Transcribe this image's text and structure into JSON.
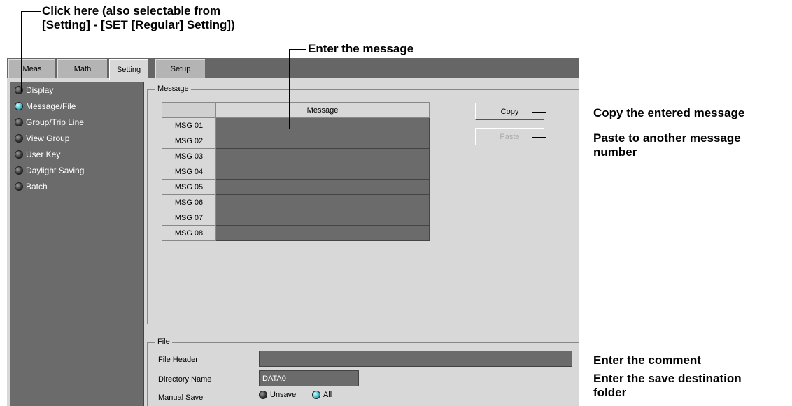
{
  "callouts": {
    "click_here_line1": "Click here (also selectable from",
    "click_here_line2": "[Setting] - [SET [Regular] Setting])",
    "enter_message": "Enter the message",
    "copy_desc": "Copy the entered message",
    "paste_desc_line1": "Paste to another message",
    "paste_desc_line2": "number",
    "enter_comment": "Enter the comment",
    "save_dest_line1": "Enter the save destination",
    "save_dest_line2": "folder"
  },
  "tabs": [
    {
      "label": "Meas",
      "active": false
    },
    {
      "label": "Math",
      "active": false
    },
    {
      "label": "Setting",
      "active": true
    },
    {
      "label": "Setup",
      "active": false
    }
  ],
  "sidebar": {
    "items": [
      {
        "label": "Display",
        "selected": false
      },
      {
        "label": "Message/File",
        "selected": true
      },
      {
        "label": "Group/Trip Line",
        "selected": false
      },
      {
        "label": "View Group",
        "selected": false
      },
      {
        "label": "User Key",
        "selected": false
      },
      {
        "label": "Daylight Saving",
        "selected": false
      },
      {
        "label": "Batch",
        "selected": false
      }
    ]
  },
  "message_group": {
    "title": "Message",
    "column_header": "Message",
    "rows": [
      "MSG 01",
      "MSG 02",
      "MSG 03",
      "MSG 04",
      "MSG 05",
      "MSG 06",
      "MSG 07",
      "MSG 08"
    ],
    "copy_label": "Copy",
    "paste_label": "Paste"
  },
  "file_group": {
    "title": "File",
    "file_header_label": "File Header",
    "file_header_value": "",
    "directory_name_label": "Directory Name",
    "directory_name_value": "DATA0",
    "manual_save_label": "Manual Save",
    "manual_save_options": [
      {
        "label": "Unsave",
        "selected": false
      },
      {
        "label": "All",
        "selected": true
      }
    ]
  },
  "colors": {
    "panel": "#d8d8d8",
    "field": "#6b6b6b",
    "tabbar": "#666666",
    "led_on": "#40b8c8"
  }
}
